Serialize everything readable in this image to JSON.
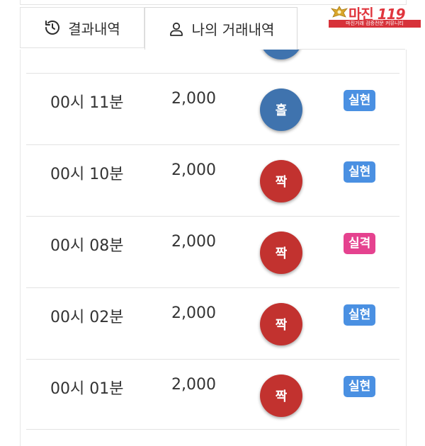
{
  "tabs": {
    "result": {
      "label": "결과내역",
      "icon": "history-icon"
    },
    "mine": {
      "label": "나의 거래내역",
      "icon": "user-icon",
      "active": true
    }
  },
  "logo": {
    "brand": "마진 ",
    "tagline": "마진거래 검증전문 커뮤니티"
  },
  "colors": {
    "odd": "#3f73ae",
    "even": "#c2322f",
    "win": "#4a90e2",
    "lose": "#e5428f"
  },
  "rows": [
    {
      "time": "00시 11분",
      "amount": "2,000",
      "pick": "홀",
      "pick_type": "odd",
      "result": "실현",
      "result_type": "win"
    },
    {
      "time": "00시 10분",
      "amount": "2,000",
      "pick": "짝",
      "pick_type": "even",
      "result": "실현",
      "result_type": "win"
    },
    {
      "time": "00시 08분",
      "amount": "2,000",
      "pick": "짝",
      "pick_type": "even",
      "result": "실격",
      "result_type": "lose"
    },
    {
      "time": "00시 02분",
      "amount": "2,000",
      "pick": "짝",
      "pick_type": "even",
      "result": "실현",
      "result_type": "win"
    },
    {
      "time": "00시 01분",
      "amount": "2,000",
      "pick": "짝",
      "pick_type": "even",
      "result": "실현",
      "result_type": "win"
    }
  ]
}
